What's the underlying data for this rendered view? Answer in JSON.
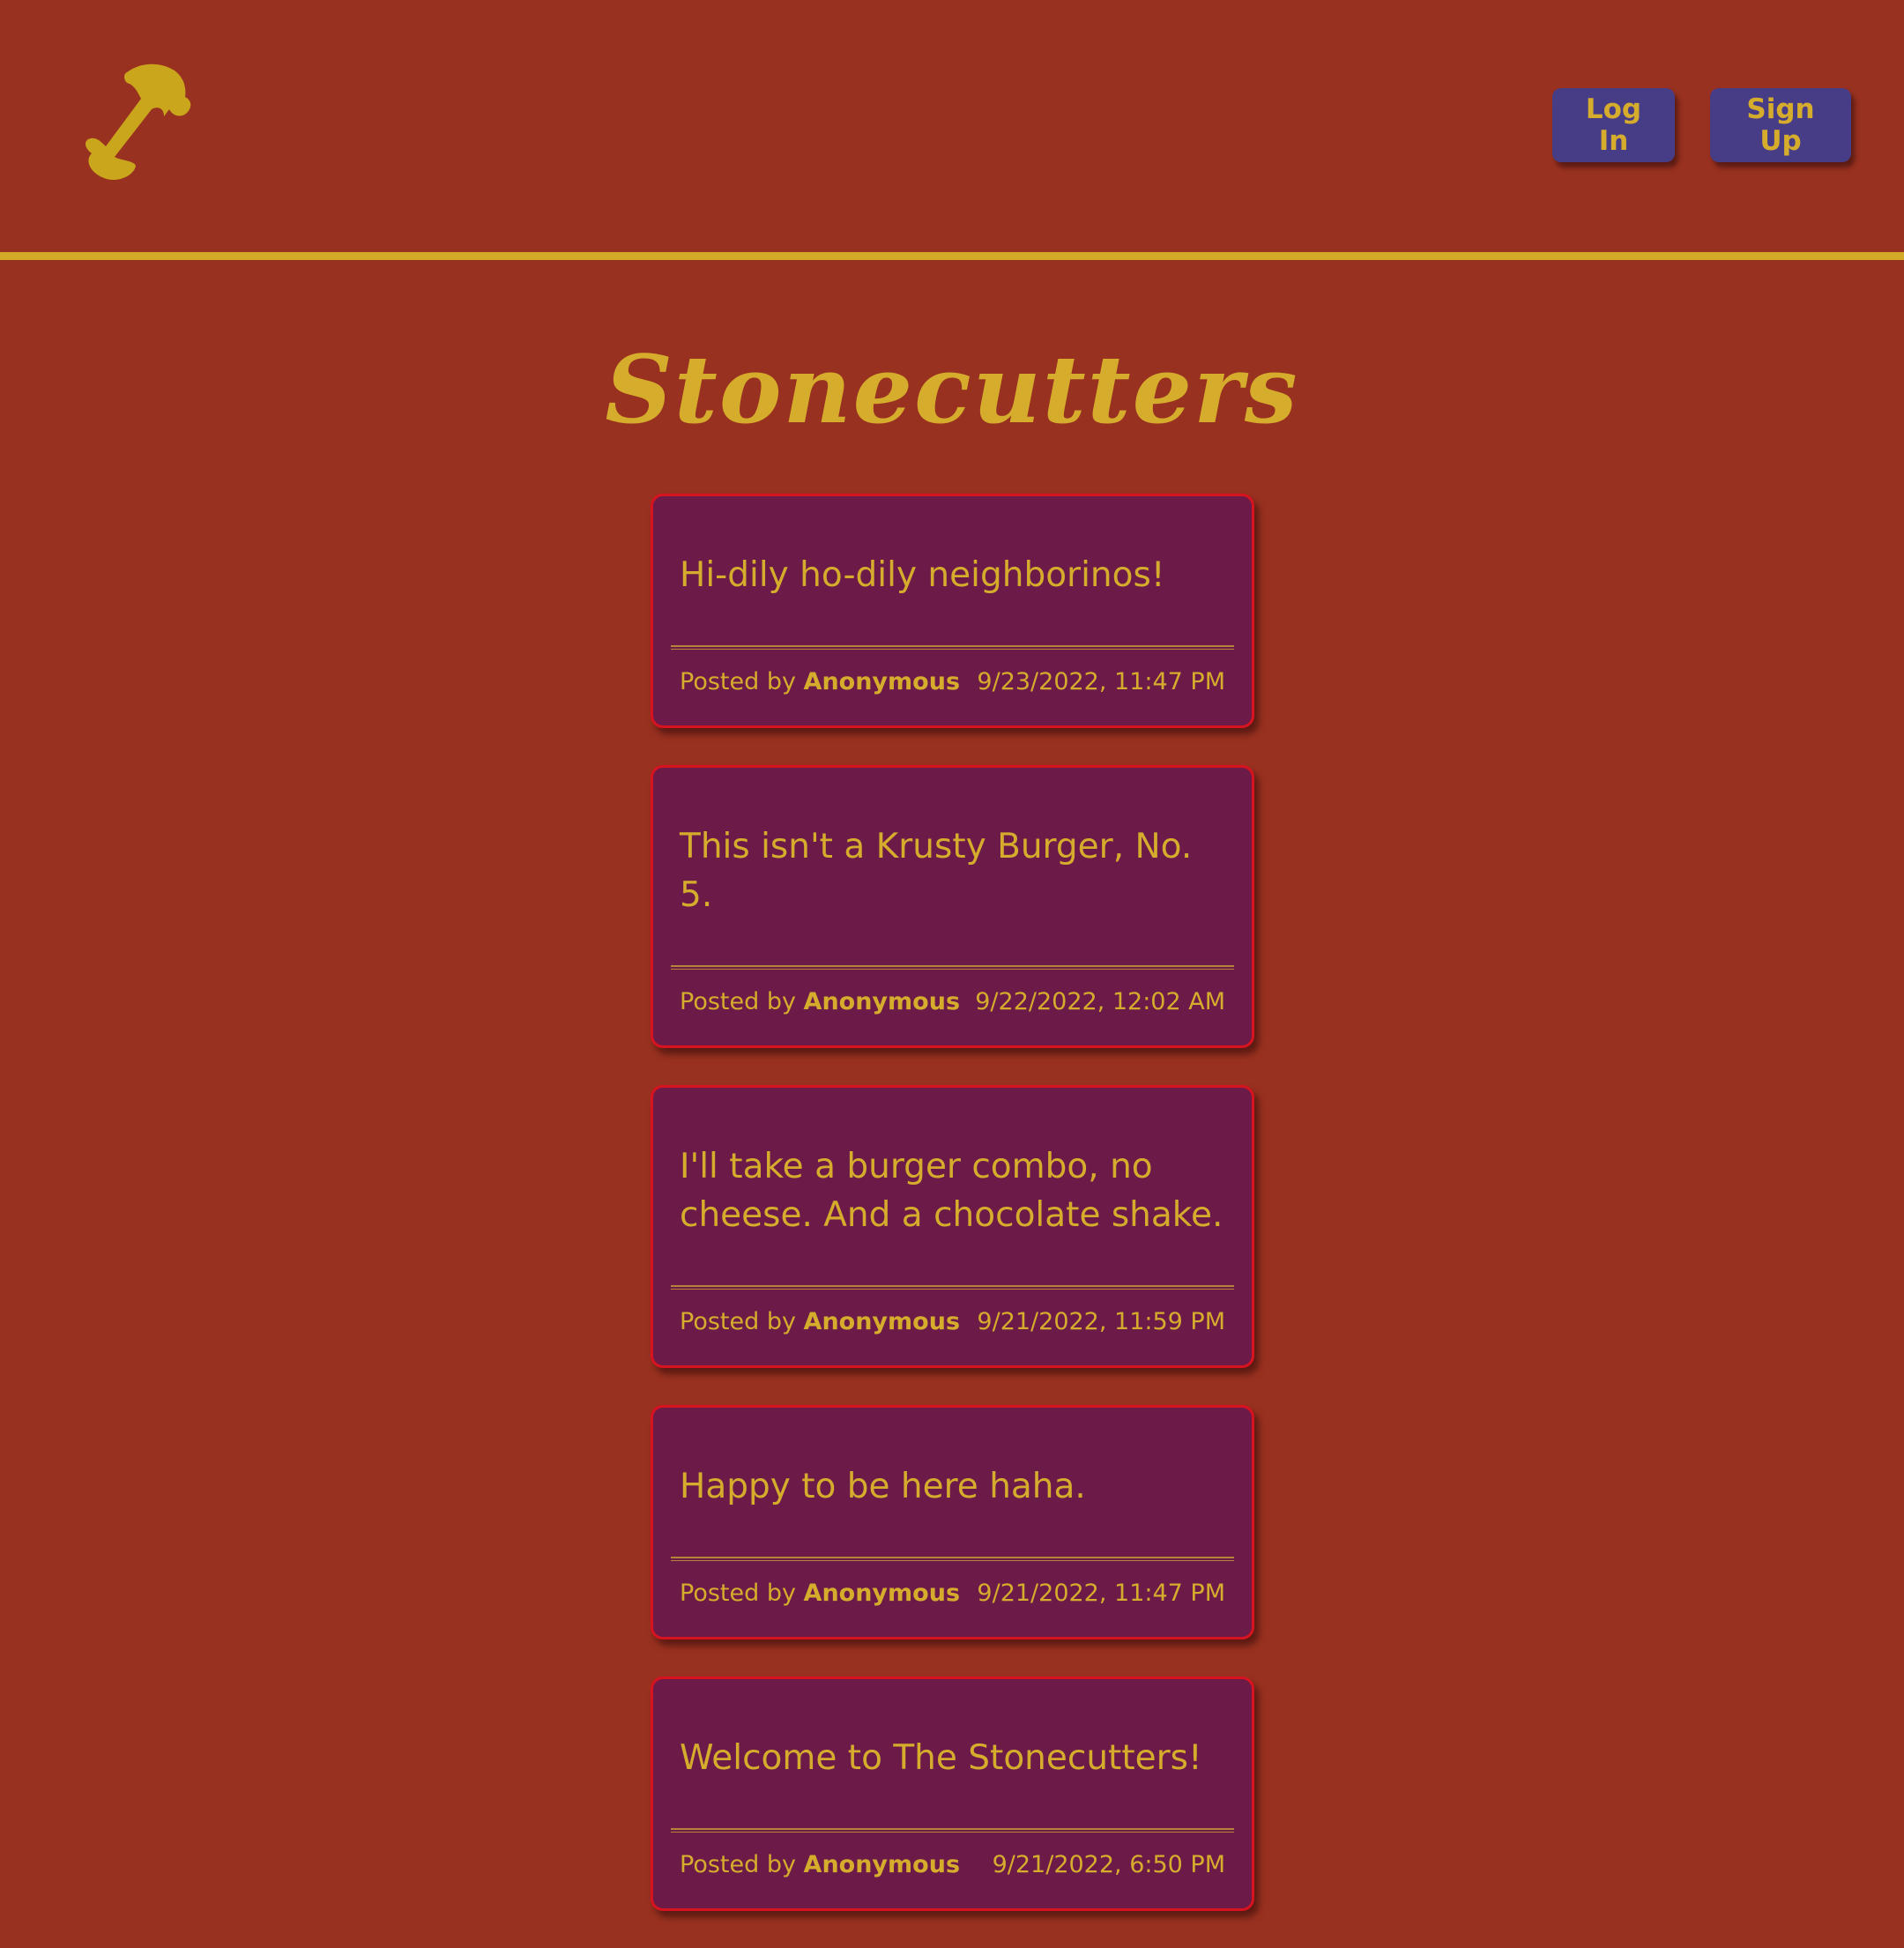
{
  "header": {
    "logo_icon": "hammer-icon",
    "login_label": "Log In",
    "signup_label": "Sign Up"
  },
  "site_title": "Stonecutters",
  "colors": {
    "background": "#993120",
    "accent_gold": "#d6ac2c",
    "card": "#6c1b49",
    "card_border": "#d81320",
    "button": "#473d87"
  },
  "posts": [
    {
      "message": "Hi-dily ho-dily neighborinos!",
      "posted_by_label": "Posted by",
      "author": "Anonymous",
      "timestamp": "9/23/2022, 11:47 PM"
    },
    {
      "message": "This isn't a Krusty Burger, No. 5.",
      "posted_by_label": "Posted by",
      "author": "Anonymous",
      "timestamp": "9/22/2022, 12:02 AM"
    },
    {
      "message": "I'll take a burger combo, no cheese. And a chocolate shake.",
      "posted_by_label": "Posted by",
      "author": "Anonymous",
      "timestamp": "9/21/2022, 11:59 PM"
    },
    {
      "message": "Happy to be here haha.",
      "posted_by_label": "Posted by",
      "author": "Anonymous",
      "timestamp": "9/21/2022, 11:47 PM"
    },
    {
      "message": "Welcome to The Stonecutters!",
      "posted_by_label": "Posted by",
      "author": "Anonymous",
      "timestamp": "9/21/2022, 6:50 PM"
    }
  ]
}
